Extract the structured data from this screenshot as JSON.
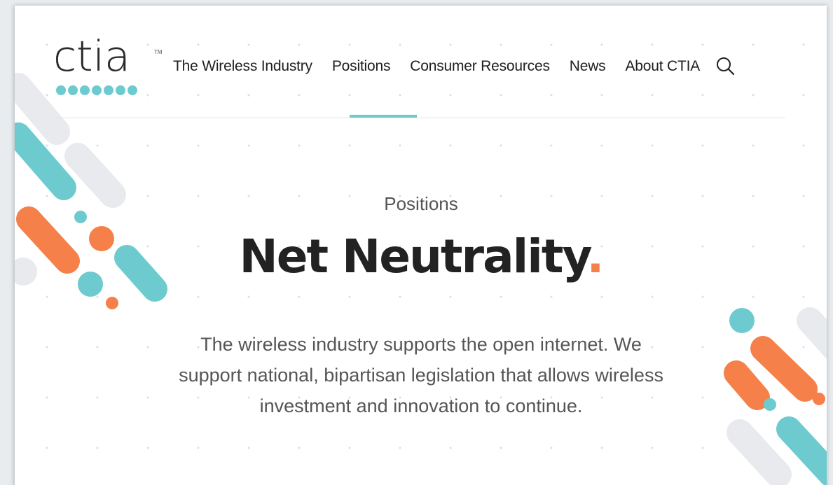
{
  "brand": {
    "name": "ctia",
    "trademark": "TM"
  },
  "nav": {
    "items": [
      {
        "label": "The Wireless Industry"
      },
      {
        "label": "Positions"
      },
      {
        "label": "Consumer Resources"
      },
      {
        "label": "News"
      },
      {
        "label": "About CTIA"
      }
    ],
    "active": "Positions"
  },
  "hero": {
    "eyebrow": "Positions",
    "title": "Net Neutrality",
    "title_dot": ".",
    "lede": "The wireless industry supports the open internet. We support national, bipartisan legislation that allows wireless investment and innovation to continue."
  },
  "colors": {
    "teal": "#6dcbd0",
    "orange": "#f5804a",
    "gray": "#e8eaed"
  },
  "icons": {
    "search": "search-icon"
  }
}
